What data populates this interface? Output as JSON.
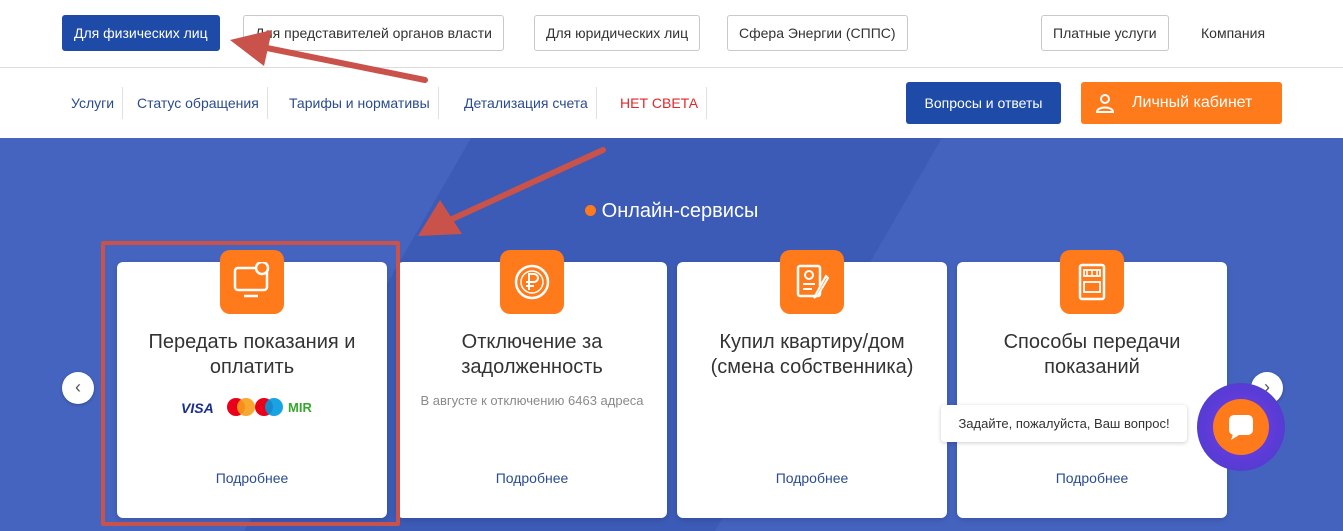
{
  "audience_tabs": [
    {
      "label": "Для физических лиц",
      "active": true
    },
    {
      "label": "Для представителей органов власти",
      "active": false
    },
    {
      "label": "Для юридических лиц",
      "active": false
    },
    {
      "label": "Сфера Энергии (СППС)",
      "active": false
    },
    {
      "label": "Платные услуги",
      "active": false
    }
  ],
  "company_link": "Компания",
  "nav": {
    "links": [
      "Услуги",
      "Статус обращения",
      "Тарифы и нормативы",
      "Детализация счета",
      "НЕТ СВЕТА"
    ],
    "faq_button": "Вопросы и ответы",
    "cabinet_button": "Личный кабинет"
  },
  "section_title": "Онлайн-сервисы",
  "cards": [
    {
      "title": "Передать показания и оплатить",
      "subtitle": "",
      "more": "Подробнее",
      "icon": "monitor-icon"
    },
    {
      "title": "Отключение за задолженность",
      "subtitle": "В августе к отключению 6463 адреса",
      "more": "Подробнее",
      "icon": "ruble-coin-icon"
    },
    {
      "title": "Купил квартиру/дом (смена собственника)",
      "subtitle": "",
      "more": "Подробнее",
      "icon": "document-pen-icon"
    },
    {
      "title": "Способы передачи показаний",
      "subtitle": "",
      "more": "Подробнее",
      "icon": "meter-icon"
    }
  ],
  "payment_logos": [
    "VISA",
    "MIR"
  ],
  "chat": {
    "tooltip": "Задайте, пожалуйста, Ваш вопрос!"
  },
  "colors": {
    "brand_blue": "#1e4aa8",
    "accent_orange": "#ff7a1a",
    "hero_blue": "#3d5ebd",
    "alert_red": "#e3262a",
    "annotation_red": "#c9524a"
  }
}
